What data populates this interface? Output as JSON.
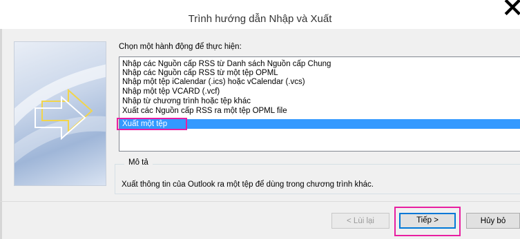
{
  "window": {
    "title": "Trình hướng dẫn Nhập và Xuất"
  },
  "prompt": "Chọn một hành động để thực hiện:",
  "actions": [
    "Nhập các Nguồn cấp RSS từ Danh sách Nguồn cấp Chung",
    "Nhập các Nguồn cấp RSS từ một tệp OPML",
    "Nhập một tệp iCalendar (.ics) hoặc vCalendar (.vcs)",
    "Nhập một tệp VCARD (.vcf)",
    "Nhập từ chương trình hoặc tệp khác",
    "Xuất các Nguồn cấp RSS ra một tệp OPML file",
    "Xuất một tệp"
  ],
  "selected_action": "Xuất một tệp",
  "description": {
    "label": "Mô tả",
    "text": "Xuất thông tin của Outlook ra một tệp để dùng trong chương trình khác."
  },
  "buttons": {
    "back": "< Lùi lại",
    "next": "Tiếp >",
    "cancel": "Hủy bỏ"
  },
  "colors": {
    "selection": "#3399ff",
    "highlight_box": "#e81ea0",
    "default_button_border": "#0078d7"
  },
  "icons": [
    "close-icon",
    "wizard-arrow-illustration"
  ]
}
